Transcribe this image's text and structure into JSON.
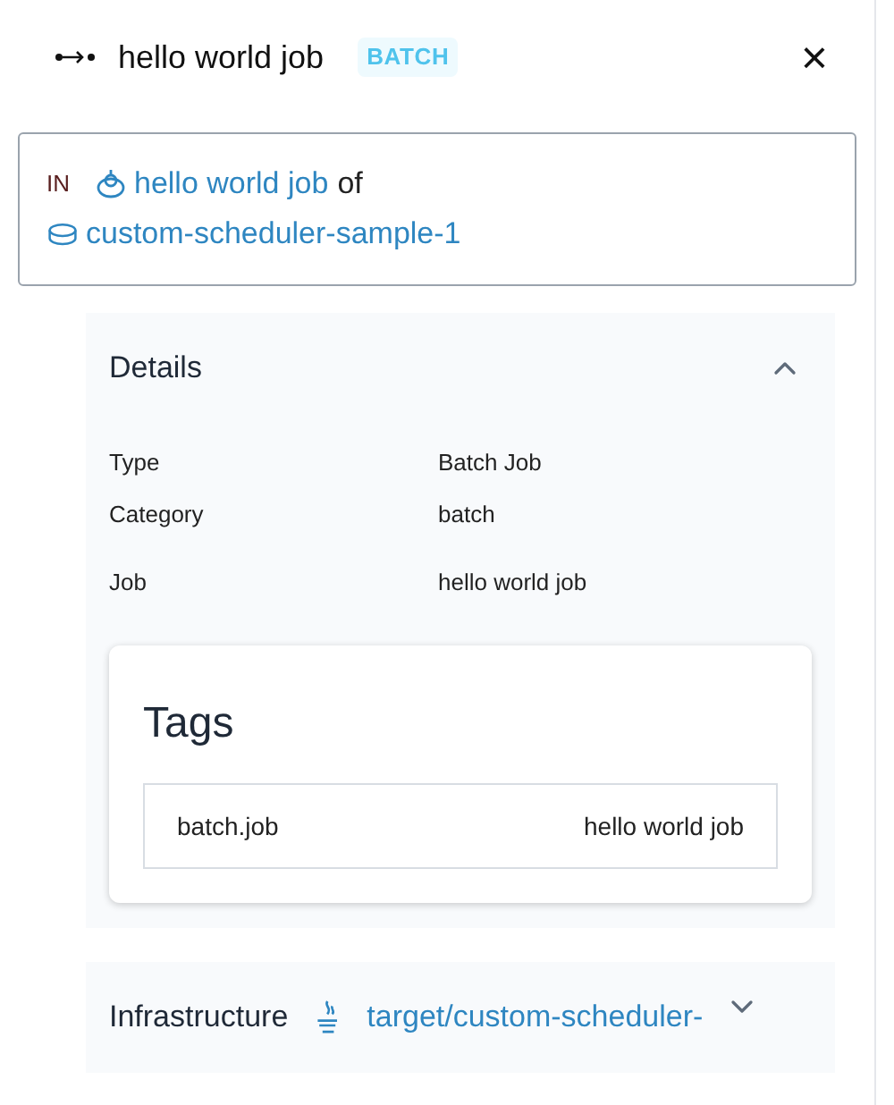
{
  "header": {
    "title": "hello world job",
    "badge": "BATCH",
    "close": "×"
  },
  "context": {
    "prefix": "IN",
    "entity": "hello world job",
    "connector": "of",
    "parent": "custom-scheduler-sample-1"
  },
  "sections": [
    {
      "kind": "details",
      "title": "Details",
      "expanded": true,
      "rows": [
        {
          "label": "Type",
          "value": "Batch Job"
        },
        {
          "label": "Category",
          "value": "batch"
        },
        {
          "label": "Job",
          "value": "hello world job"
        }
      ],
      "tags": {
        "title": "Tags",
        "items": [
          {
            "key": "batch.job",
            "value": "hello world job"
          }
        ]
      }
    },
    {
      "kind": "infrastructure",
      "title": "Infrastructure",
      "link": "target/custom-scheduler-",
      "expanded": false
    }
  ]
}
